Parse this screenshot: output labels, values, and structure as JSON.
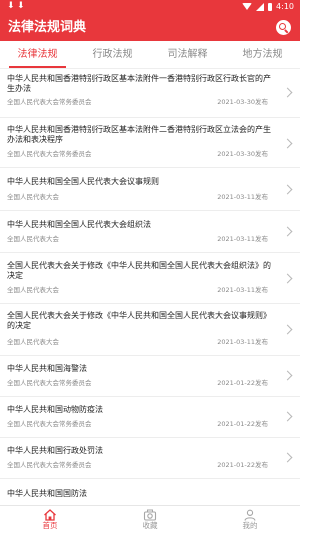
{
  "status_bar": {
    "time": "4:10",
    "download_glyph": "⬇"
  },
  "app_bar": {
    "title": "法律法规词典",
    "search_icon": "search-icon"
  },
  "tabs": [
    {
      "label": "法律法规",
      "active": true
    },
    {
      "label": "行政法规",
      "active": false
    },
    {
      "label": "司法解释",
      "active": false
    },
    {
      "label": "地方法规",
      "active": false
    }
  ],
  "items": [
    {
      "title": "中华人民共和国香港特别行政区基本法附件一香港特别行政区行政长官的产生办法",
      "source": "全国人民代表大会常务委员会",
      "date": "2021-03-30发布"
    },
    {
      "title": "中华人民共和国香港特别行政区基本法附件二香港特别行政区立法会的产生办法和表决程序",
      "source": "全国人民代表大会常务委员会",
      "date": "2021-03-30发布"
    },
    {
      "title": "中华人民共和国全国人民代表大会议事规则",
      "source": "全国人民代表大会",
      "date": "2021-03-11发布"
    },
    {
      "title": "中华人民共和国全国人民代表大会组织法",
      "source": "全国人民代表大会",
      "date": "2021-03-11发布"
    },
    {
      "title": "全国人民代表大会关于修改《中华人民共和国全国人民代表大会组织法》的决定",
      "source": "全国人民代表大会",
      "date": "2021-03-11发布"
    },
    {
      "title": "全国人民代表大会关于修改《中华人民共和国全国人民代表大会议事规则》的决定",
      "source": "全国人民代表大会",
      "date": "2021-03-11发布"
    },
    {
      "title": "中华人民共和国海警法",
      "source": "全国人民代表大会常务委员会",
      "date": "2021-01-22发布"
    },
    {
      "title": "中华人民共和国动物防疫法",
      "source": "全国人民代表大会常务委员会",
      "date": "2021-01-22发布"
    },
    {
      "title": "中华人民共和国行政处罚法",
      "source": "全国人民代表大会常务委员会",
      "date": "2021-01-22发布"
    },
    {
      "title": "中华人民共和国国防法",
      "source": "",
      "date": ""
    }
  ],
  "bottom_nav": [
    {
      "label": "首页",
      "icon": "home-icon",
      "active": true
    },
    {
      "label": "收藏",
      "icon": "camera-icon",
      "active": false
    },
    {
      "label": "我的",
      "icon": "user-icon",
      "active": false
    }
  ],
  "colors": {
    "accent": "#e8373c",
    "text": "#222222",
    "muted": "#8a8a8a"
  }
}
